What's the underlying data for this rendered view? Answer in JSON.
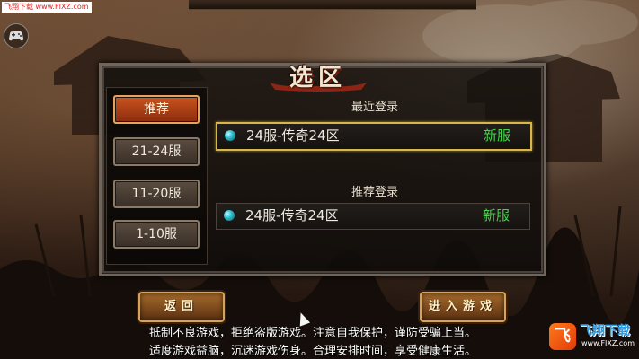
{
  "top_watermark": "飞翔下载 www.FIXZ.com",
  "title": "选区",
  "tabs": [
    {
      "label": "推荐",
      "active": true
    },
    {
      "label": "21-24服",
      "active": false
    },
    {
      "label": "11-20服",
      "active": false
    },
    {
      "label": "1-10服",
      "active": false
    }
  ],
  "recent": {
    "label": "最近登录",
    "server": {
      "name": "24服-传奇24区",
      "status": "新服",
      "selected": true
    }
  },
  "recommended": {
    "label": "推荐登录",
    "server": {
      "name": "24服-传奇24区",
      "status": "新服",
      "selected": false
    }
  },
  "buttons": {
    "back": "返回",
    "enter": "进入游戏"
  },
  "notice": {
    "line1": "抵制不良游戏，拒绝盗版游戏。注意自我保护，谨防受骗上当。",
    "line2": "适度游戏益脑，沉迷游戏伤身。合理安排时间，享受健康生活。"
  },
  "site_logo": {
    "mark": "飞",
    "name": "飞翔下载",
    "url": "www.FIXZ.com"
  },
  "colors": {
    "accent_gold": "#d6b74a",
    "active_tab": "#c9531e",
    "status_green": "#46d54b"
  },
  "icons": {
    "gamepad": "gamepad-icon",
    "server_indicator": "server-status-orb-icon",
    "cursor": "mouse-pointer-icon"
  }
}
